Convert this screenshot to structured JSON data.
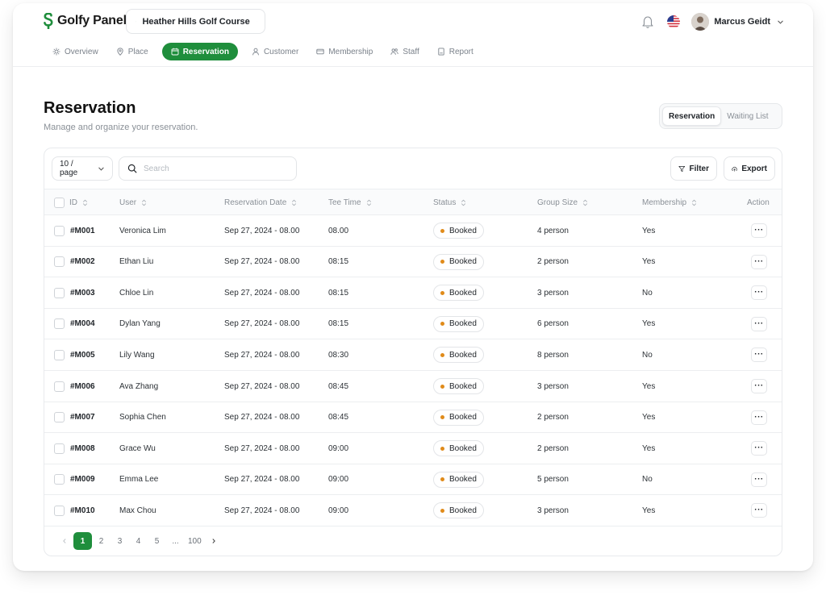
{
  "app": {
    "name": "Golfy Panel",
    "course": "Heather Hills Golf Course",
    "user_name": "Marcus Geidt"
  },
  "nav": [
    {
      "label": "Overview",
      "icon": "sun-icon",
      "active": false
    },
    {
      "label": "Place",
      "icon": "pin-icon",
      "active": false
    },
    {
      "label": "Reservation",
      "icon": "calendar-icon",
      "active": true
    },
    {
      "label": "Customer",
      "icon": "person-icon",
      "active": false
    },
    {
      "label": "Membership",
      "icon": "card-icon",
      "active": false
    },
    {
      "label": "Staff",
      "icon": "people-icon",
      "active": false
    },
    {
      "label": "Report",
      "icon": "report-icon",
      "active": false
    }
  ],
  "page": {
    "title": "Reservation",
    "subtitle": "Manage and organize your reservation.",
    "segments": [
      "Reservation",
      "Waiting List"
    ]
  },
  "toolbar": {
    "per_page": "10 / page",
    "search_placeholder": "Search",
    "filter_label": "Filter",
    "export_label": "Export"
  },
  "table": {
    "headers": [
      "ID",
      "User",
      "Reservation Date",
      "Tee Time",
      "Status",
      "Group Size",
      "Membership",
      "Action"
    ],
    "rows": [
      {
        "id": "#M001",
        "user": "Veronica Lim",
        "date": "Sep 27, 2024 - 08.00",
        "tee": "08.00",
        "status": "Booked",
        "group": "4 person",
        "membership": "Yes"
      },
      {
        "id": "#M002",
        "user": "Ethan Liu",
        "date": "Sep 27, 2024 - 08.00",
        "tee": "08:15",
        "status": "Booked",
        "group": "2 person",
        "membership": "Yes"
      },
      {
        "id": "#M003",
        "user": "Chloe Lin",
        "date": "Sep 27, 2024 - 08.00",
        "tee": "08:15",
        "status": "Booked",
        "group": "3 person",
        "membership": "No"
      },
      {
        "id": "#M004",
        "user": "Dylan Yang",
        "date": "Sep 27, 2024 - 08.00",
        "tee": "08:15",
        "status": "Booked",
        "group": "6 person",
        "membership": "Yes"
      },
      {
        "id": "#M005",
        "user": "Lily Wang",
        "date": "Sep 27, 2024 - 08.00",
        "tee": "08:30",
        "status": "Booked",
        "group": "8 person",
        "membership": "No"
      },
      {
        "id": "#M006",
        "user": "Ava Zhang",
        "date": "Sep 27, 2024 - 08.00",
        "tee": "08:45",
        "status": "Booked",
        "group": "3 person",
        "membership": "Yes"
      },
      {
        "id": "#M007",
        "user": "Sophia Chen",
        "date": "Sep 27, 2024 - 08.00",
        "tee": "08:45",
        "status": "Booked",
        "group": "2 person",
        "membership": "Yes"
      },
      {
        "id": "#M008",
        "user": "Grace Wu",
        "date": "Sep 27, 2024 - 08.00",
        "tee": "09:00",
        "status": "Booked",
        "group": "2 person",
        "membership": "Yes"
      },
      {
        "id": "#M009",
        "user": "Emma Lee",
        "date": "Sep 27, 2024 - 08.00",
        "tee": "09:00",
        "status": "Booked",
        "group": "5 person",
        "membership": "No"
      },
      {
        "id": "#M010",
        "user": "Max Chou",
        "date": "Sep 27, 2024 - 08.00",
        "tee": "09:00",
        "status": "Booked",
        "group": "3 person",
        "membership": "Yes"
      }
    ],
    "action_label": "···"
  },
  "pagination": {
    "pages": [
      "1",
      "2",
      "3",
      "4",
      "5",
      "...",
      "100"
    ],
    "current": "1"
  },
  "colors": {
    "accent": "#1f8e3c",
    "status_dot": "#e08b1a"
  }
}
